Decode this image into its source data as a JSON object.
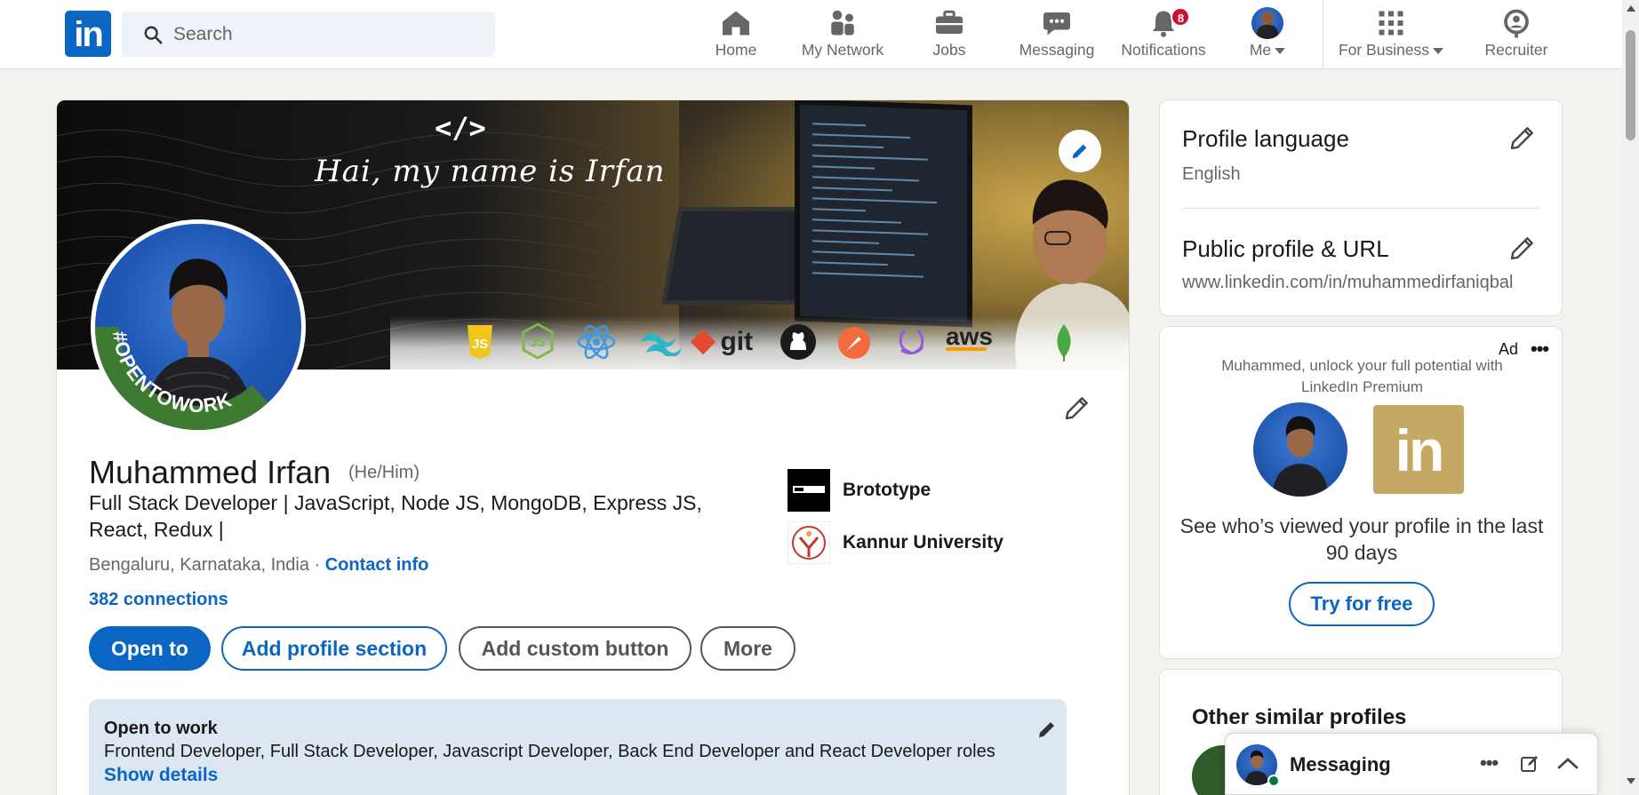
{
  "nav": {
    "search_placeholder": "Search",
    "items": [
      {
        "label": "Home",
        "icon": "home-icon"
      },
      {
        "label": "My Network",
        "icon": "network-icon"
      },
      {
        "label": "Jobs",
        "icon": "briefcase-icon"
      },
      {
        "label": "Messaging",
        "icon": "chat-icon"
      },
      {
        "label": "Notifications",
        "icon": "bell-icon",
        "badge": "8"
      },
      {
        "label": "Me",
        "icon": "avatar"
      },
      {
        "label": "For Business",
        "icon": "grid-icon"
      },
      {
        "label": "Recruiter",
        "icon": "recruiter-icon"
      }
    ]
  },
  "profile": {
    "banner_code": "</>",
    "banner_text": "Hai, my name is Irfan",
    "tech_labels": {
      "js": "JS",
      "git": "git",
      "aws": "aws"
    },
    "open_to_work_ring": "#OPENTOWORK",
    "name": "Muhammed Irfan",
    "pronouns": "(He/Him)",
    "headline": "Full Stack Developer | JavaScript, Node JS, MongoDB, Express JS, React, Redux |",
    "location": "Bengaluru, Karnataka, India",
    "location_sep": " · ",
    "contact_info": "Contact info",
    "connections": "382 connections",
    "orgs": [
      {
        "name": "Brototype"
      },
      {
        "name": "Kannur University"
      }
    ],
    "buttons": {
      "open_to": "Open to",
      "add_section": "Add profile section",
      "add_custom": "Add custom button",
      "more": "More"
    },
    "open_to_work": {
      "title": "Open to work",
      "roles": "Frontend Developer, Full Stack Developer, Javascript Developer, Back End Developer and React Developer roles",
      "show_details": "Show details"
    }
  },
  "sidebar": {
    "profile_language_title": "Profile language",
    "profile_language_value": "English",
    "public_profile_title": "Public profile & URL",
    "public_profile_url": "www.linkedin.com/in/muhammedirfaniqbal",
    "ad_label": "Ad",
    "ad_text": "Muhammed, unlock your full potential with LinkedIn Premium",
    "ad_body": "See who’s viewed your profile in the last 90 days",
    "ad_button": "Try for free",
    "ad_logo": "in",
    "similar_title": "Other similar profiles"
  },
  "messaging": {
    "title": "Messaging"
  },
  "colors": {
    "brand": "#0a66c2",
    "badge": "#cb112d",
    "open_to_work_green": "#3f7a33",
    "premium_gold": "#c5a863"
  }
}
